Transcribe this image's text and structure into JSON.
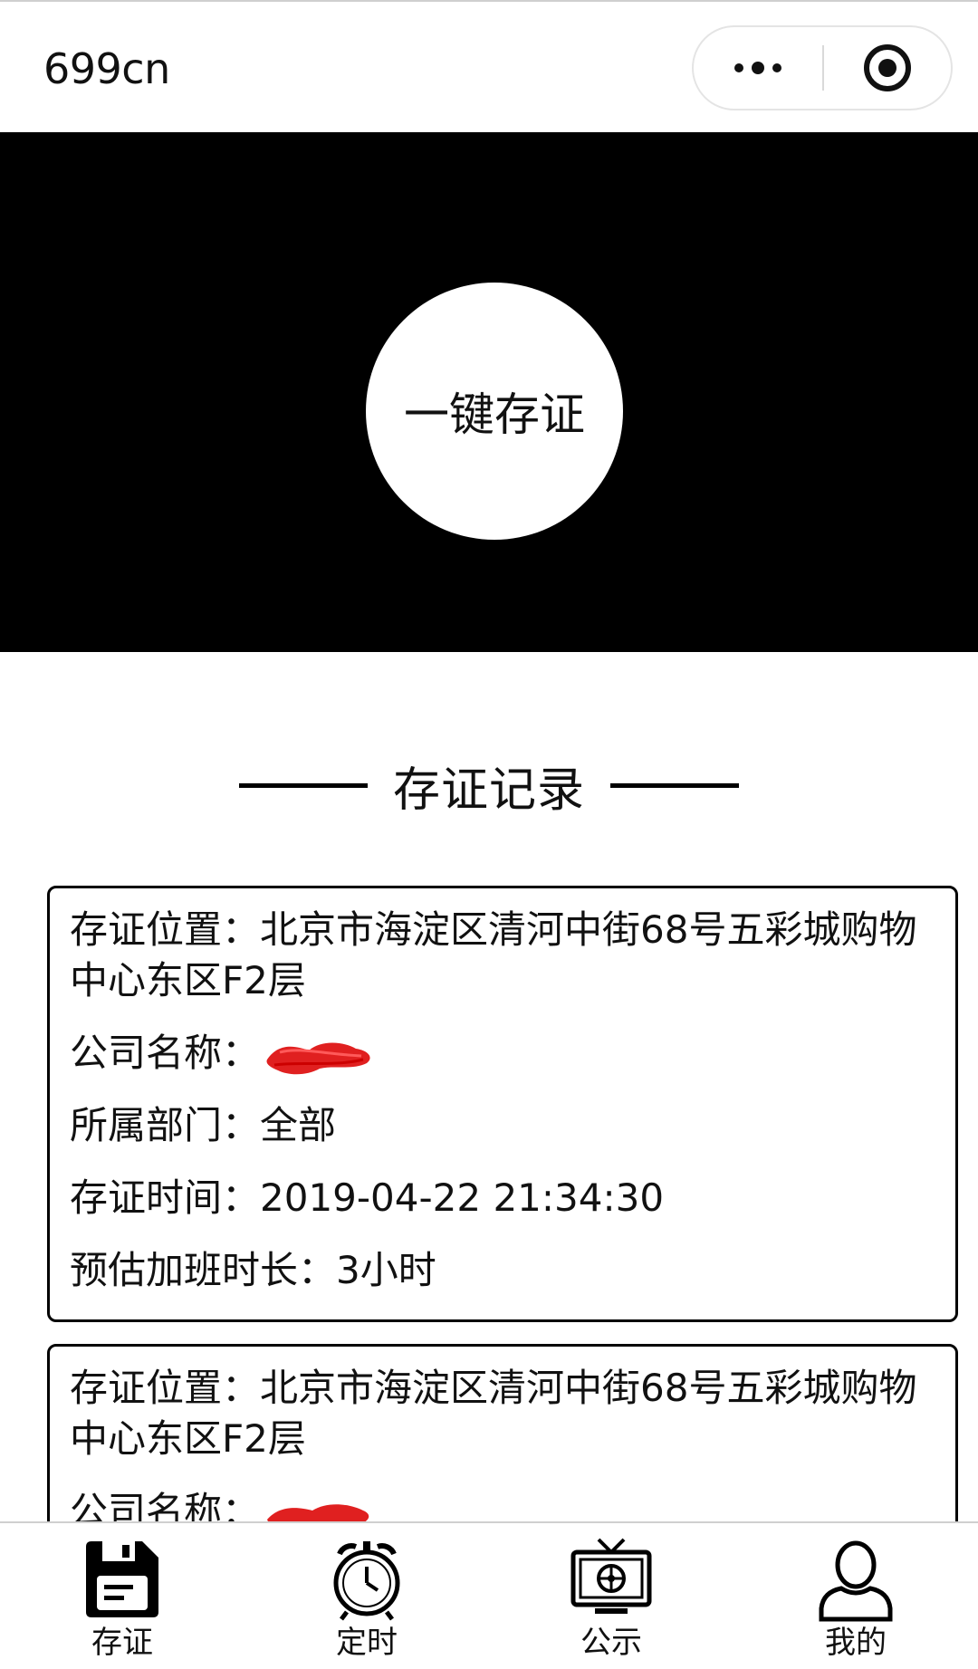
{
  "navbar": {
    "title": "699cn",
    "more_icon": "more-dots-icon",
    "close_icon": "target-circle-icon"
  },
  "banner": {
    "button_label": "一键存证",
    "background": "#000000"
  },
  "section": {
    "title": "存证记录"
  },
  "records": [
    {
      "location_label": "存证位置：",
      "location_value": "北京市海淀区清河中街68号五彩城购物中心东区F2层",
      "company_label": "公司名称：",
      "department_label": "所属部门：",
      "department_value": "全部",
      "time_label": "存证时间：",
      "time_value": "2019-04-22 21:34:30",
      "overtime_label": "预估加班时长：",
      "overtime_value": "3小时"
    },
    {
      "location_label": "存证位置：",
      "location_value": "北京市海淀区清河中街68号五彩城购物中心东区F2层",
      "company_label": "公司名称："
    }
  ],
  "tabbar": {
    "items": [
      {
        "label": "存证",
        "icon": "floppy-disk-icon",
        "active": true
      },
      {
        "label": "定时",
        "icon": "alarm-clock-icon",
        "active": false
      },
      {
        "label": "公示",
        "icon": "tv-icon",
        "active": false
      },
      {
        "label": "我的",
        "icon": "user-icon",
        "active": false
      }
    ]
  },
  "colors": {
    "redaction": "#e02020",
    "border": "#000000"
  }
}
